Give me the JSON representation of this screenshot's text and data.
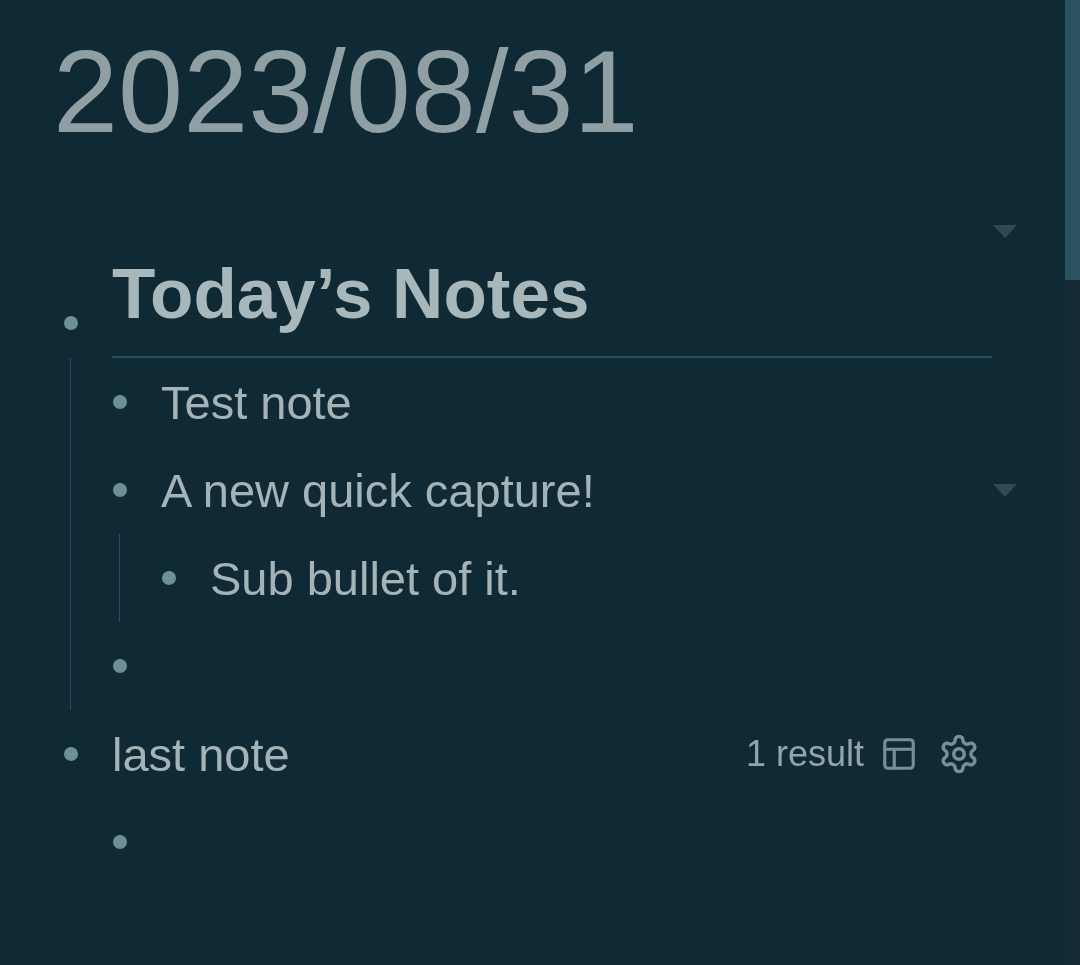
{
  "title": "2023/08/31",
  "blocks": [
    {
      "kind": "heading",
      "text": "Today’s Notes",
      "collapsible": true,
      "children": [
        {
          "kind": "text",
          "text": "Test note"
        },
        {
          "kind": "text",
          "text": "A new quick capture!",
          "collapsible": true,
          "children": [
            {
              "kind": "text",
              "text": "Sub bullet of it."
            }
          ]
        },
        {
          "kind": "empty"
        }
      ]
    },
    {
      "kind": "query",
      "text": "last note",
      "result_count": "1 result",
      "children": [
        {
          "kind": "empty"
        }
      ]
    }
  ]
}
